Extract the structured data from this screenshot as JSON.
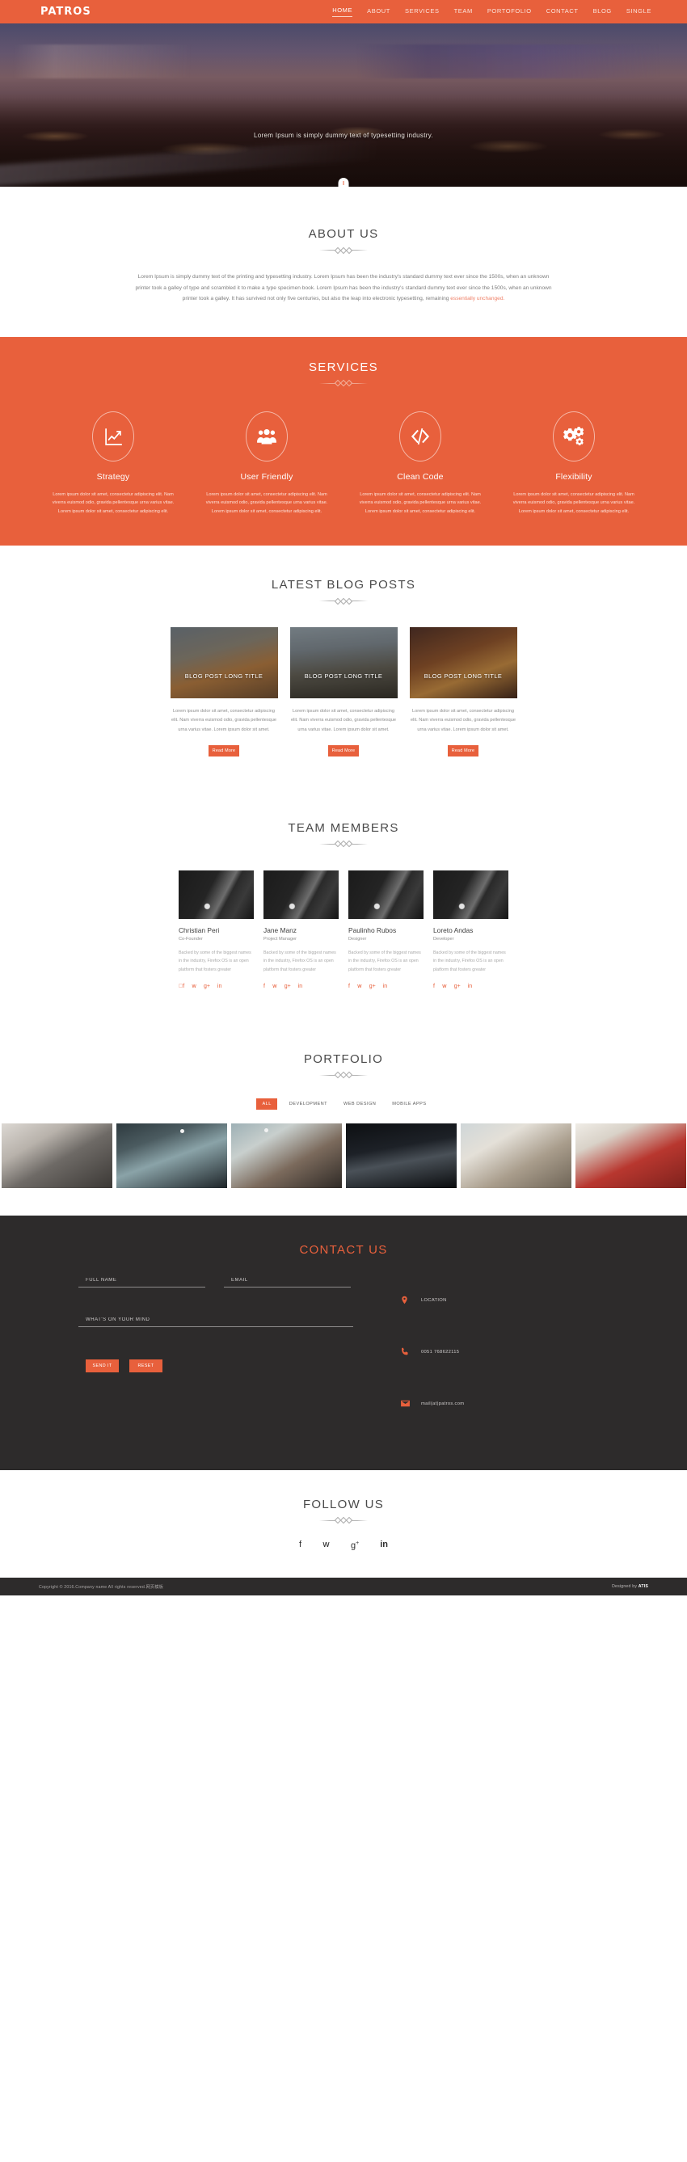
{
  "nav": {
    "brand": "PATROS",
    "items": [
      {
        "label": "HOME",
        "active": true
      },
      {
        "label": "ABOUT",
        "active": false
      },
      {
        "label": "SERVICES",
        "active": false
      },
      {
        "label": "TEAM",
        "active": false
      },
      {
        "label": "PORTOFOLIO",
        "active": false
      },
      {
        "label": "CONTACT",
        "active": false
      },
      {
        "label": "BLOG",
        "active": false
      },
      {
        "label": "SINGLE",
        "active": false
      }
    ]
  },
  "hero": {
    "caption": "Lorem Ipsum is simply dummy text of typesetting industry.",
    "scroll_icon": "mouse-scroll-icon"
  },
  "about": {
    "title": "ABOUT US",
    "body": "Lorem Ipsum is simply dummy text of the printing and typesetting industry. Lorem Ipsum has been the industry's standard dummy text ever since the 1500s, when an unknown printer took a galley of type and scrambled it to make a type specimen book. Lorem Ipsum has been the industry's standard dummy text ever since the 1500s, when an unknown printer took a galley. It has survived not only five centuries, but also the leap into electronic typesetting, remaining ",
    "highlight": "essentially unchanged."
  },
  "services": {
    "title": "SERVICES",
    "accent": "#e8603c",
    "items": [
      {
        "icon": "chart-line-icon",
        "title": "Strategy",
        "text": "Lorem ipsum dolor sit amet, consectetur adipiscing elit. Nam viverra euismod odio, gravida pellentesque urna varius vitae. Lorem ipsum dolor sit amet, consectetur adipiscing elit."
      },
      {
        "icon": "users-group-icon",
        "title": "User Friendly",
        "text": "Lorem ipsum dolor sit amet, consectetur adipiscing elit. Nam viverra euismod odio, gravida pellentesque urna varius vitae. Lorem ipsum dolor sit amet, consectetur adipiscing elit."
      },
      {
        "icon": "code-brackets-icon",
        "title": "Clean Code",
        "text": "Lorem ipsum dolor sit amet, consectetur adipiscing elit. Nam viverra euismod odio, gravida pellentesque urna varius vitae. Lorem ipsum dolor sit amet, consectetur adipiscing elit."
      },
      {
        "icon": "gears-icon",
        "title": "Flexibility",
        "text": "Lorem ipsum dolor sit amet, consectetur adipiscing elit. Nam viverra euismod odio, gravida pellentesque urna varius vitae. Lorem ipsum dolor sit amet, consectetur adipiscing elit."
      }
    ]
  },
  "blog": {
    "title": "LATEST BLOG POSTS",
    "posts": [
      {
        "title": "BLOG POST LONG TITLE",
        "excerpt": "Lorem ipsum dolor sit amet, consectetur adipiscing elit. Nam viverra euismod odio, gravida pellentesque urna varius vitae. Lorem ipsum dolor sit amet.",
        "button": "Read More"
      },
      {
        "title": "BLOG POST LONG TITLE",
        "excerpt": "Lorem ipsum dolor sit amet, consectetur adipiscing elit. Nam viverra euismod odio, gravida pellentesque urna varius vitae. Lorem ipsum dolor sit amet.",
        "button": "Read More"
      },
      {
        "title": "BLOG POST LONG TITLE",
        "excerpt": "Lorem ipsum dolor sit amet, consectetur adipiscing elit. Nam viverra euismod odio, gravida pellentesque urna varius vitae. Lorem ipsum dolor sit amet.",
        "button": "Read More"
      }
    ]
  },
  "team": {
    "title": "TEAM MEMBERS",
    "members": [
      {
        "name": "Christian Peri",
        "role": "Co-Founder",
        "bio": "Backed by some of the biggest names in the industry, Firefox OS is an open platform that fosters greater",
        "socials": [
          "facebook-icon",
          "twitter-icon",
          "google-plus-icon",
          "linkedin-icon"
        ]
      },
      {
        "name": "Jane Manz",
        "role": "Project Manager",
        "bio": "Backed by some of the biggest names in the industry, Firefox OS is an open platform that fosters greater",
        "socials": [
          "facebook-icon",
          "twitter-icon",
          "google-plus-icon",
          "linkedin-icon"
        ]
      },
      {
        "name": "Paulinho Rubos",
        "role": "Designer",
        "bio": "Backed by some of the biggest names in the industry, Firefox OS is an open platform that fosters greater",
        "socials": [
          "facebook-icon",
          "twitter-icon",
          "google-plus-icon",
          "linkedin-icon"
        ]
      },
      {
        "name": "Loreto Andas",
        "role": "Developer",
        "bio": "Backed by some of the biggest names in the industry, Firefox OS is an open platform that fosters greater",
        "socials": [
          "facebook-icon",
          "twitter-icon",
          "google-plus-icon",
          "linkedin-icon"
        ]
      }
    ]
  },
  "portfolio": {
    "title": "PORTFOLIO",
    "filters": [
      {
        "label": "ALL",
        "active": true
      },
      {
        "label": "DEVELOPMENT",
        "active": false
      },
      {
        "label": "WEB DESIGN",
        "active": false
      },
      {
        "label": "MOBILE APPS",
        "active": false
      }
    ]
  },
  "contact": {
    "title": "CONTACT US",
    "fields": {
      "fullname_placeholder": "FULL NAME",
      "fullname_value": "",
      "email_placeholder": "EMAIL",
      "email_value": "",
      "message_placeholder": "WHAT'S ON YOUR MIND",
      "message_value": ""
    },
    "send_label": "SEND IT",
    "reset_label": "RESET",
    "info": [
      {
        "icon": "map-pin-icon",
        "text": "LOCATION"
      },
      {
        "icon": "phone-icon",
        "text": "0051 768622115"
      },
      {
        "icon": "envelope-icon",
        "text": "mail(at)patros.com"
      }
    ]
  },
  "follow": {
    "title": "FOLLOW US",
    "icons": [
      "facebook-icon",
      "twitter-icon",
      "google-plus-icon",
      "linkedin-icon"
    ]
  },
  "footer": {
    "copyright": "Copyright © 2016.Company name All rights reserved.网页模板",
    "credit_prefix": "Designed by ",
    "credit_name": "ATIS"
  }
}
